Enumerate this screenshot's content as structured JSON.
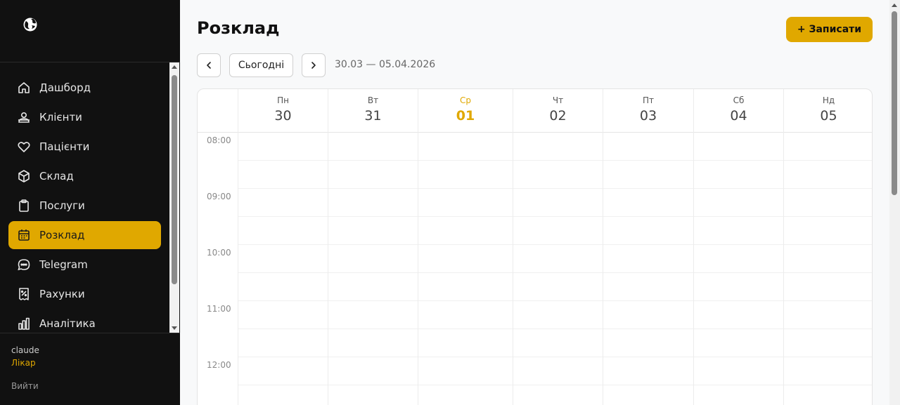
{
  "sidebar": {
    "logo_icon": "globe-logo-icon",
    "items": [
      {
        "label": "Дашборд",
        "icon": "home-icon",
        "active": false
      },
      {
        "label": "Клієнти",
        "icon": "users-icon",
        "active": false
      },
      {
        "label": "Пацієнти",
        "icon": "heart-icon",
        "active": false
      },
      {
        "label": "Склад",
        "icon": "box-icon",
        "active": false
      },
      {
        "label": "Послуги",
        "icon": "clipboard-icon",
        "active": false
      },
      {
        "label": "Розклад",
        "icon": "calendar-icon",
        "active": true
      },
      {
        "label": "Telegram",
        "icon": "chat-icon",
        "active": false
      },
      {
        "label": "Рахунки",
        "icon": "receipt-icon",
        "active": false
      },
      {
        "label": "Аналітика",
        "icon": "bar-chart-icon",
        "active": false
      }
    ],
    "user": {
      "name": "claude",
      "role": "Лікар",
      "logout": "Вийти"
    }
  },
  "header": {
    "title": "Розклад",
    "add_button": "+ Записати",
    "today_button": "Сьогодні",
    "date_range": "30.03 — 05.04.2026"
  },
  "calendar": {
    "days": [
      {
        "name": "Пн",
        "num": "30",
        "today": false
      },
      {
        "name": "Вт",
        "num": "31",
        "today": false
      },
      {
        "name": "Ср",
        "num": "01",
        "today": true
      },
      {
        "name": "Чт",
        "num": "02",
        "today": false
      },
      {
        "name": "Пт",
        "num": "03",
        "today": false
      },
      {
        "name": "Сб",
        "num": "04",
        "today": false
      },
      {
        "name": "Нд",
        "num": "05",
        "today": false
      }
    ],
    "times": [
      "08:00",
      "09:00",
      "10:00",
      "11:00",
      "12:00"
    ]
  },
  "colors": {
    "accent": "#e0a800",
    "sidebar_bg": "#111111"
  }
}
